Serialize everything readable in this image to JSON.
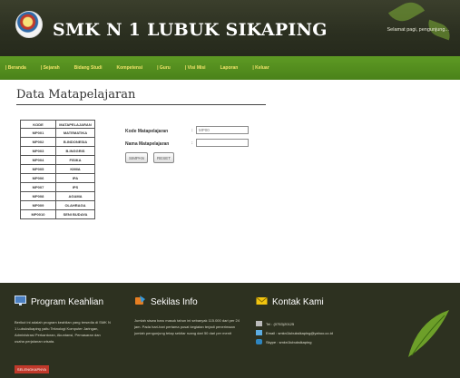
{
  "header": {
    "site_title": "SMK N 1 LUBUK SIKAPING",
    "welcome_text": "Selamat pagi, pengunjung..."
  },
  "nav": {
    "items": [
      "| Beranda",
      "| Sejarah",
      "Bidang Studi",
      "Kompetensi",
      "| Guru",
      "| Visi Misi",
      "Laporan",
      "| Keluar"
    ]
  },
  "main": {
    "page_title": "Data Matapelajaran"
  },
  "subject_table": {
    "headers": [
      "KODE",
      "MATAPELAJARAN"
    ],
    "rows": [
      [
        "MP001",
        "MATEMATIKA"
      ],
      [
        "MP002",
        "B.INDONESIA"
      ],
      [
        "MP003",
        "B.INGGRIS"
      ],
      [
        "MP004",
        "FISIKA"
      ],
      [
        "MP005",
        "KIMIA"
      ],
      [
        "MP006",
        "IPA"
      ],
      [
        "MP007",
        "IPS"
      ],
      [
        "MP008",
        "AGAMA"
      ],
      [
        "MP009",
        "OLAHRAGA"
      ],
      [
        "MP0010",
        "SENI BUDAYA"
      ]
    ]
  },
  "form": {
    "kode_label": "Kode Matapelajaran",
    "kode_value": "MP00",
    "nama_label": "Nama Matapelajaran",
    "nama_value": "",
    "colon": ":",
    "save_label": "SIMPAN",
    "reset_label": "RESET"
  },
  "footer": {
    "program": {
      "title": "Program Keahlian",
      "text": "Berikut ini adalah program keahlian yang tersedia di SMK N 1 Lubuksikaping yaitu Teknologi Komputer Jaringan, Administrasi Perkantoran, Akuntansi, Pemasaran dan usaha perjalanan wisata.",
      "button": "SELENGKAPNYA"
    },
    "info": {
      "title": "Sekilas Info",
      "text": "Jumlah siswa baru masuk tahun ini sebanyak 115.000 dari per 24 jam. Pada hari-hari pertama pusat kegiatan terjadi penerimaan jumlah pengunjung tetap sekitar ruang dari 50 dari per menit"
    },
    "contact": {
      "title": "Kontak Kami",
      "telp": "Tel : (0753)20125",
      "email": "Email : smkn1lubuksikaping@yahoo.co.id",
      "skype": "Skype : smkn1lubuksikaping"
    }
  },
  "colors": {
    "header_bg": "#2b2f20",
    "nav_bg": "#4a8219",
    "nav_text": "#f2e36a",
    "footer_bg": "#2d3120",
    "accent_red": "#c0392b"
  }
}
